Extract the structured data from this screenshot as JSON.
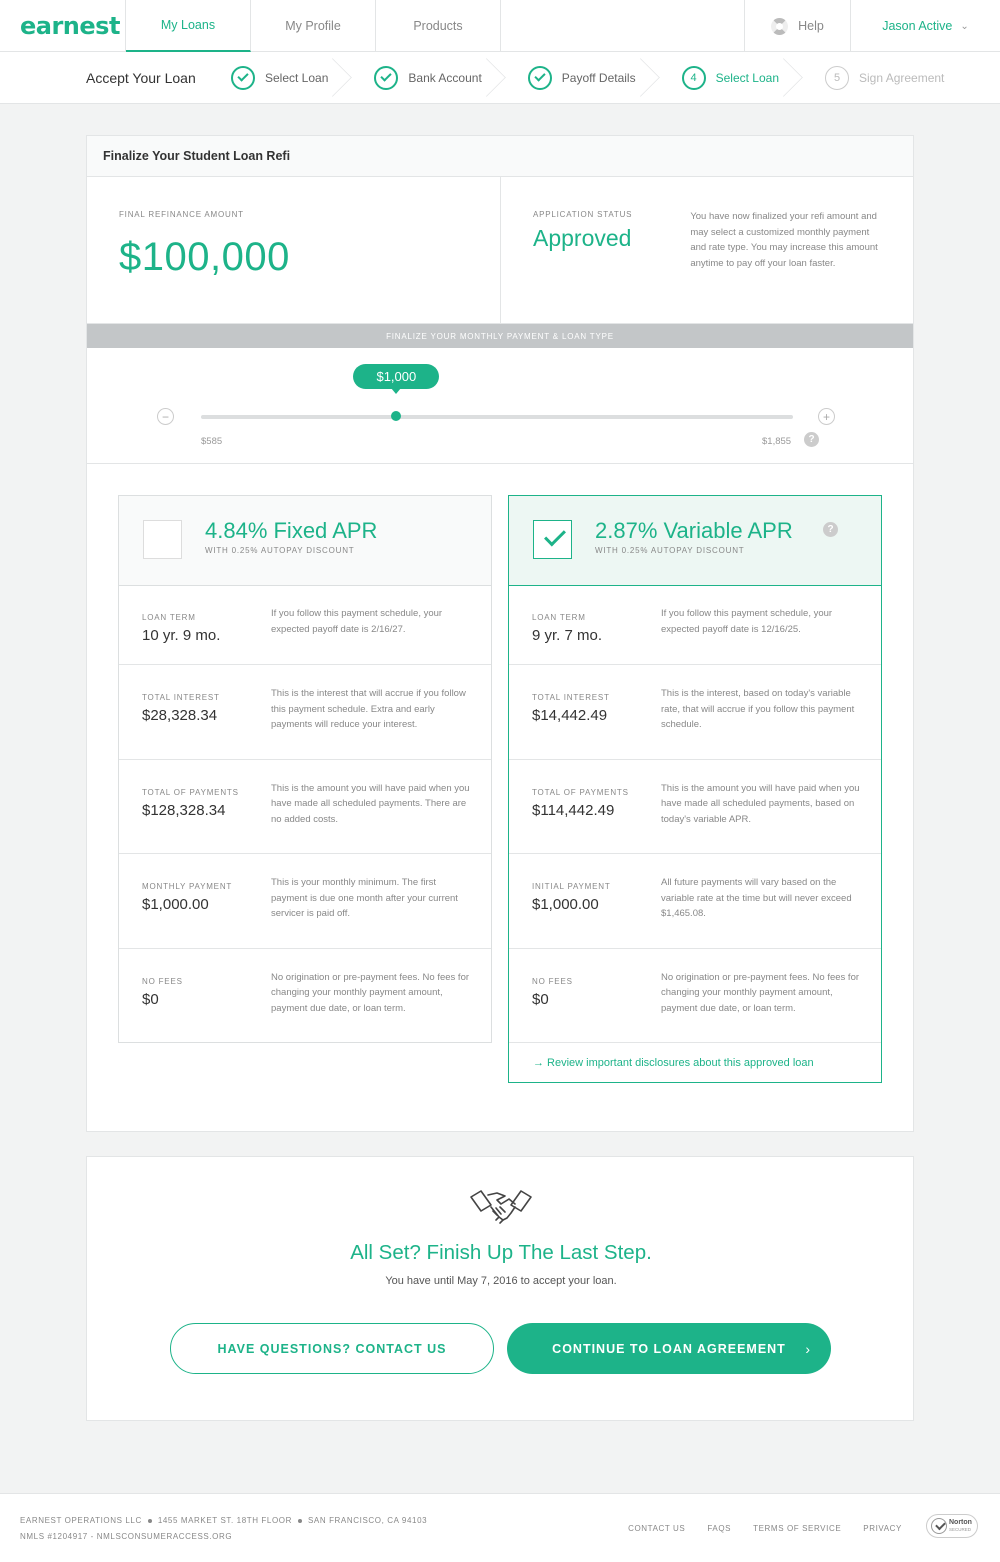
{
  "nav": {
    "logo": "earnest",
    "tabs": [
      {
        "label": "My Loans"
      },
      {
        "label": "My Profile"
      },
      {
        "label": "Products"
      }
    ],
    "help": "Help",
    "user": "Jason Active"
  },
  "steps": {
    "title": "Accept Your Loan",
    "items": [
      {
        "label": "Select Loan",
        "state": "done"
      },
      {
        "label": "Bank Account",
        "state": "done"
      },
      {
        "label": "Payoff Details",
        "state": "done"
      },
      {
        "number": "4",
        "label": "Select Loan",
        "state": "current"
      },
      {
        "number": "5",
        "label": "Sign Agreement",
        "state": "pending"
      }
    ]
  },
  "card": {
    "title": "Finalize Your Student Loan Refi",
    "refi_label": "Final Refinance Amount",
    "refi_amount": "$100,000",
    "status_label": "Application Status",
    "status_value": "Approved",
    "status_desc": "You have now finalized your refi amount and may select a customized monthly payment and rate type. You may increase this amount anytime to pay off your loan faster."
  },
  "slider": {
    "band": "Finalize Your Monthly Payment & Loan Type",
    "value": "$1,000",
    "min": "$585",
    "max": "$1,855",
    "position": 0.33,
    "minus": "−",
    "plus": "+",
    "help": "?"
  },
  "fixed": {
    "title": "4.84% Fixed APR",
    "subtitle": "With 0.25% Autopay Discount",
    "selected": false,
    "rows": [
      {
        "label": "Loan Term",
        "value": "10 yr. 9 mo.",
        "desc": "If you follow this payment schedule, your expected payoff date is 2/16/27."
      },
      {
        "label": "Total Interest",
        "value": "$28,328.34",
        "desc": "This is the interest that will accrue if you follow this payment schedule. Extra and early payments will reduce your interest."
      },
      {
        "label": "Total of Payments",
        "value": "$128,328.34",
        "desc": "This is the amount you will have paid when you have made all scheduled payments. There are no added costs."
      },
      {
        "label": "Monthly Payment",
        "value": "$1,000.00",
        "desc": "This is your monthly minimum. The first payment is due one month after your current servicer is paid off."
      },
      {
        "label": "No Fees",
        "value": "$0",
        "desc": "No origination or pre-payment fees. No fees for changing your monthly payment amount, payment due date, or loan term."
      }
    ]
  },
  "variable": {
    "title": "2.87% Variable APR",
    "subtitle": "With 0.25% Autopay Discount",
    "selected": true,
    "help": "?",
    "rows": [
      {
        "label": "Loan Term",
        "value": "9 yr. 7 mo.",
        "desc": "If you follow this payment schedule, your expected payoff date is 12/16/25."
      },
      {
        "label": "Total Interest",
        "value": "$14,442.49",
        "desc": "This is the interest, based on today's variable rate, that will accrue if you follow this payment schedule."
      },
      {
        "label": "Total of Payments",
        "value": "$114,442.49",
        "desc": "This is the amount you will have paid when you have made all scheduled payments, based on today's variable APR."
      },
      {
        "label": "Initial Payment",
        "value": "$1,000.00",
        "desc": "All future payments will vary based on the variable rate at the time but will never exceed $1,465.08."
      },
      {
        "label": "No Fees",
        "value": "$0",
        "desc": "No origination or pre-payment fees. No fees for changing your monthly payment amount, payment due date, or loan term."
      }
    ],
    "disclosure": "→ Review important disclosures about this approved loan"
  },
  "cta": {
    "title": "All Set? Finish Up The Last Step.",
    "subtitle": "You have until May 7, 2016 to accept your loan.",
    "contact_btn": "Have Questions? Contact Us",
    "continue_btn": "Continue To Loan Agreement",
    "continue_arrow": "›"
  },
  "footer": {
    "company": "Earnest Operations LLC",
    "address": "1455 Market St. 18th Floor",
    "city": "San Francisco, CA 94103",
    "nmls": "NMLS #1204917 - NMLSConsumerAccess.org",
    "links": [
      "Contact Us",
      "FAQs",
      "Terms of Service",
      "Privacy"
    ],
    "badge_name": "Norton",
    "badge_sub": "SECURED"
  },
  "colors": {
    "accent": "#1db389",
    "background": "#f2f3f3",
    "band": "#c3c6c8"
  },
  "icons": {
    "help": "lifebuoy-icon",
    "user_menu": "chevron-down-icon",
    "cta": "handshake-icon"
  }
}
